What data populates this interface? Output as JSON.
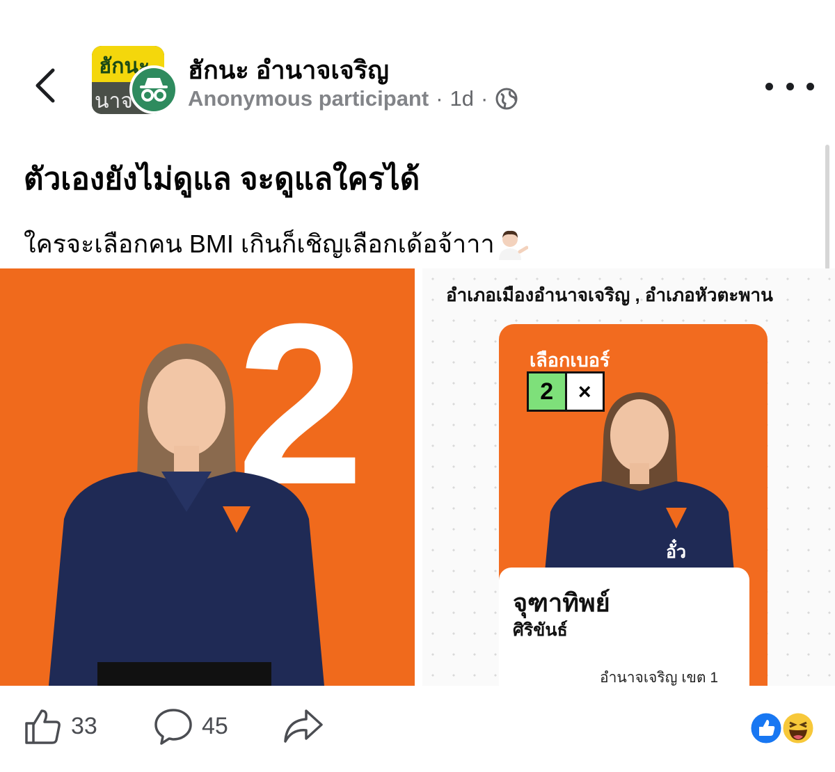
{
  "header": {
    "group_name": "ฮักนะ อำนาจเจริญ",
    "group_avatar_top": "ฮักนะ",
    "group_avatar_bottom": "นาจ",
    "author": "Anonymous participant",
    "separator": "·",
    "time": "1d",
    "privacy_icon": "globe-icon",
    "back_icon": "chevron-left-icon",
    "more_icon": "more-dots-icon"
  },
  "post": {
    "headline": "ตัวเองยังไม่ดูแล จะดูแลใครได้",
    "text": "ใครจะเลือกคน BMI เกินก็เชิญเลือกเด้อจ้าาา",
    "emoji": "person-shrugging-icon"
  },
  "images": {
    "left": {
      "number": "2"
    },
    "right": {
      "district": "อำเภอเมืองอำนาจเจริญ , อำเภอหัวตะพาน",
      "card_label": "เลือกเบอร์",
      "ballot_number": "2",
      "ballot_mark": "×",
      "nickname": "อั๋ว",
      "first_name": "จุฑาทิพย์",
      "last_name": "ศิริขันธ์",
      "area": "อำนาจเจริญ เขต 1"
    }
  },
  "actions": {
    "like_count": "33",
    "comment_count": "45",
    "like_icon": "thumbs-up-icon",
    "comment_icon": "comment-bubble-icon",
    "share_icon": "share-arrow-icon",
    "reaction_icons": [
      "like-reaction-icon",
      "haha-reaction-icon"
    ]
  },
  "colors": {
    "accent_orange": "#f06a1c",
    "facebook_blue": "#1877f2",
    "text_secondary": "#65676b"
  }
}
